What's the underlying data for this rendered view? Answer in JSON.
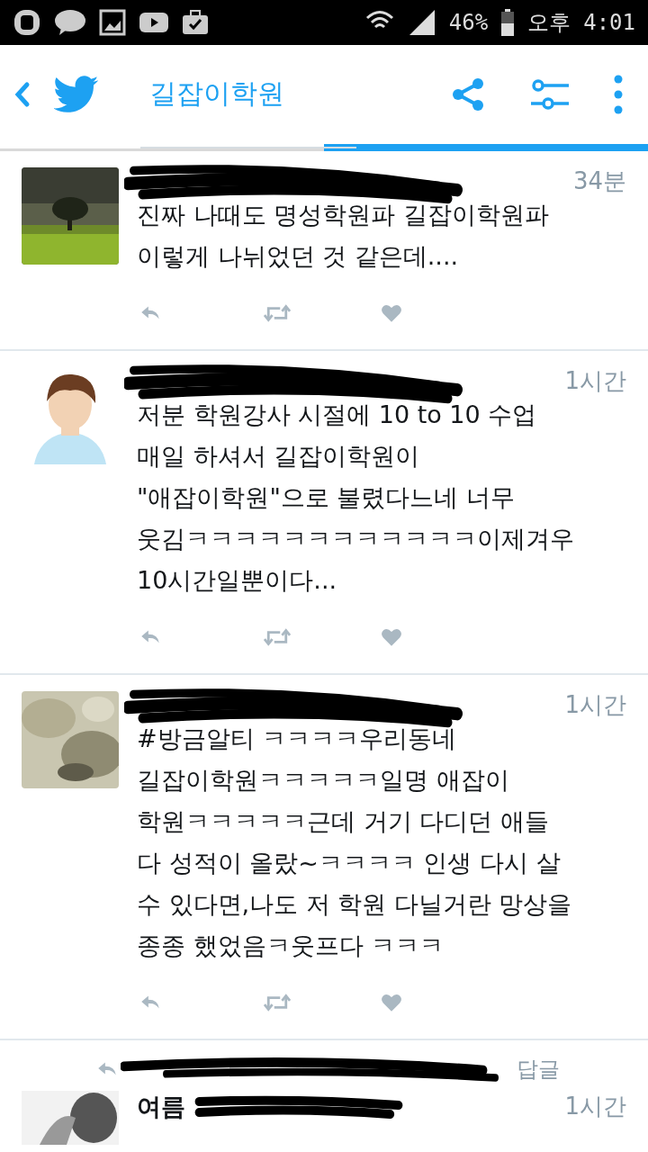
{
  "status_bar": {
    "battery": "46%",
    "period": "오후",
    "time": "4:01"
  },
  "header": {
    "title": "길잡이학원"
  },
  "tabs": [
    {
      "selected": false
    },
    {
      "selected": true
    }
  ],
  "tweets": [
    {
      "time": "34분",
      "text": "진짜 나때도 명성학원파 길잡이학원파\n이렇게 나뉘었던 것 같은데...."
    },
    {
      "time": "1시간",
      "text": "저분 학원강사 시절에 10 to 10 수업\n매일 하셔서 길잡이학원이\n\"애잡이학원\"으로 불렸다느네 너무\n웃김ㅋㅋㅋㅋㅋㅋㅋㅋㅋㅋㅋㅋ이제겨우\n10시간일뿐이다..."
    },
    {
      "time": "1시간",
      "text": "#방금알티 ㅋㅋㅋㅋ우리동네\n길잡이학원ㅋㅋㅋㅋㅋ일명 애잡이\n학원ㅋㅋㅋㅋㅋ근데 거기 다디던 애들\n다 성적이 올랐~ㅋㅋㅋㅋ 인생 다시 살\n수 있다면,나도 저 학원 다닐거란 망상을\n종종 했었음ㅋ웃프다 ㅋㅋㅋ"
    }
  ],
  "partial_tweet": {
    "context": "답글",
    "name": "여름",
    "time": "1시간"
  }
}
